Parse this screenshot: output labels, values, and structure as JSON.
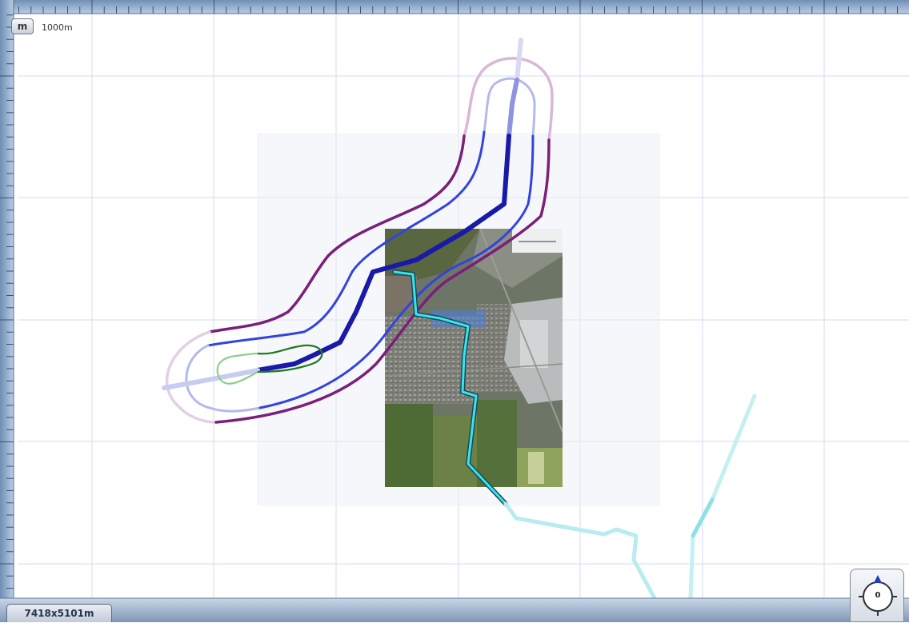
{
  "toolbar": {
    "unit_button": "m",
    "scale_label": "1000m"
  },
  "status_bar": {
    "dimensions": "7418x5101m"
  },
  "compass": {
    "heading": "0",
    "icon": "compass-icon"
  },
  "map": {
    "imagery": "aerial-photo-overlay",
    "colors": {
      "main_route": "#1a1aa8",
      "buffer_inner": "#3344dd",
      "buffer_outer": "#7a1f7a",
      "connector_route": "#2ec8d8",
      "area_outline": "#1e7a1e",
      "selection_area": "#4a7fe0"
    }
  }
}
